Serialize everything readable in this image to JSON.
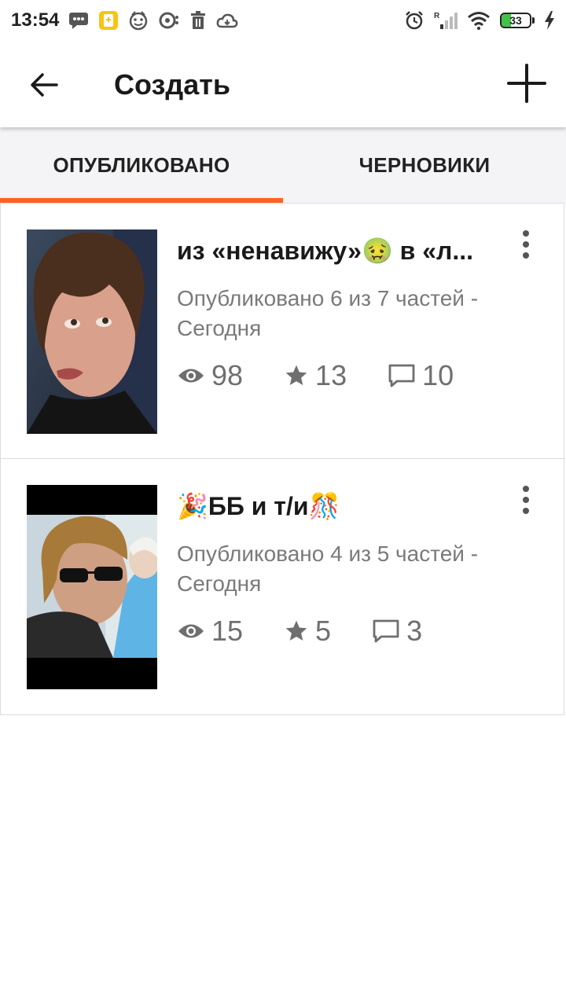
{
  "status_bar": {
    "time": "13:54",
    "battery_level": "33",
    "icons": [
      "message-icon",
      "clipboard-icon",
      "face-icon",
      "sync-icon",
      "trash-icon",
      "cloud-icon",
      "alarm-icon",
      "signal-icon",
      "wifi-icon",
      "battery-icon",
      "charging-icon"
    ]
  },
  "appbar": {
    "title": "Создать",
    "back_icon": "arrow-left-icon",
    "add_icon": "plus-icon"
  },
  "tabs": [
    {
      "label": "ОПУБЛИКОВАНО",
      "active": true
    },
    {
      "label": "ЧЕРНОВИКИ",
      "active": false
    }
  ],
  "accent_color": "#ff6122",
  "stories": [
    {
      "title": "из «ненавижу»🤢 в «л...",
      "meta": "Опубликовано 6 из 7 частей - Сегодня",
      "views": "98",
      "votes": "13",
      "comments": "10"
    },
    {
      "title": "🎉ББ и т/и🎊",
      "meta": "Опубликовано 4 из 5 частей - Сегодня",
      "views": "15",
      "votes": "5",
      "comments": "3"
    }
  ]
}
